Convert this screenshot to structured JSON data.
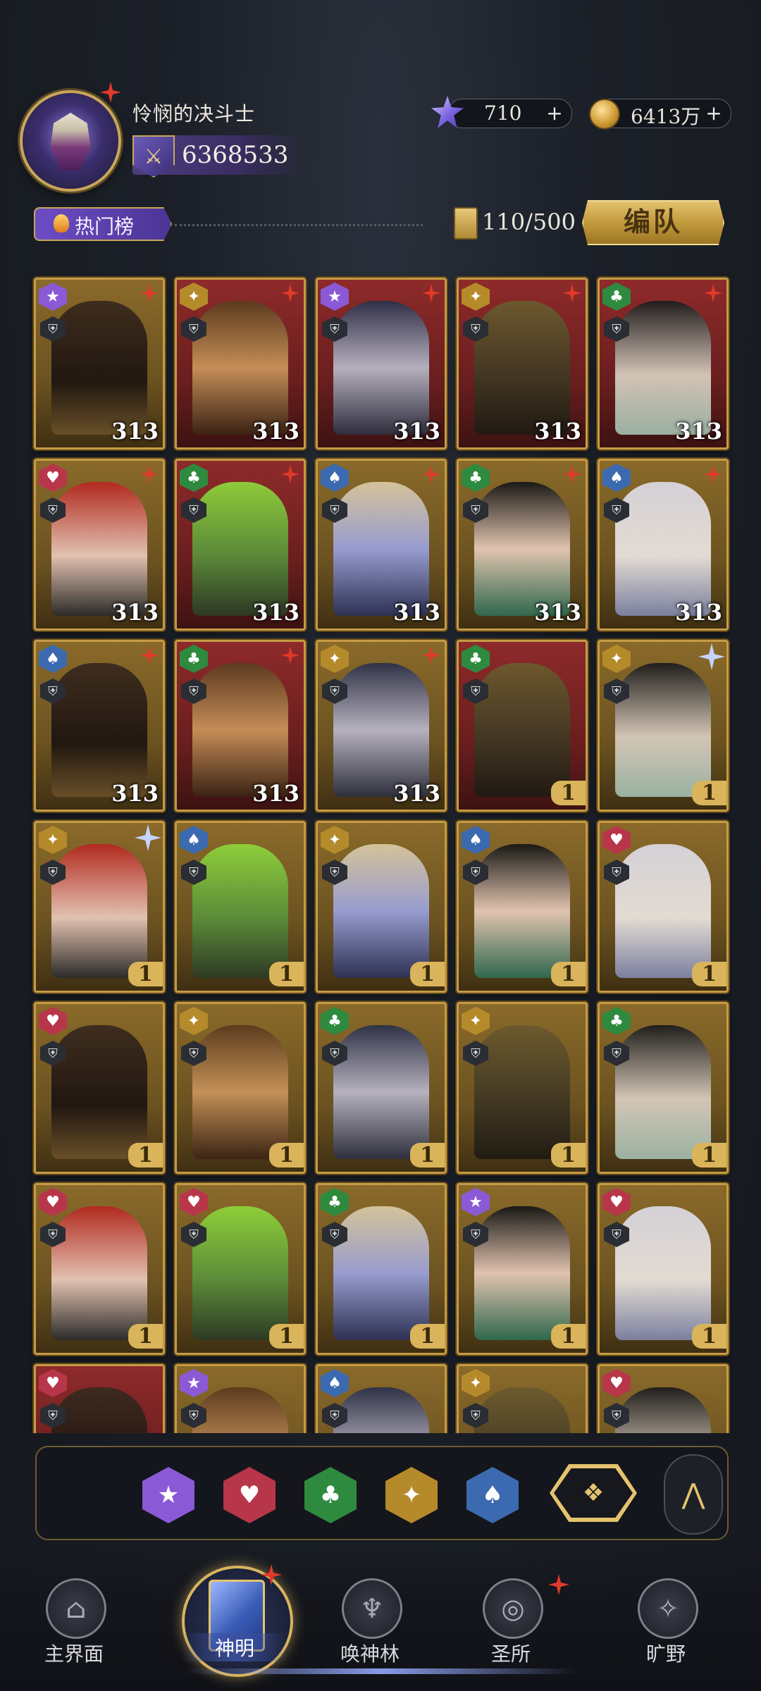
{
  "header": {
    "player_name": "怜悯的决斗士",
    "power": "6368533",
    "gems": "710",
    "coins": "6413万",
    "plus": "+"
  },
  "toolbar": {
    "hot_tab_label": "热门榜",
    "roster_count": "110/500",
    "team_button_label": "编队"
  },
  "cards": [
    {
      "faction": "star",
      "color": "gold",
      "level": "313"
    },
    {
      "faction": "diamond",
      "color": "red",
      "level": "313"
    },
    {
      "faction": "star",
      "color": "red",
      "level": "313"
    },
    {
      "faction": "diamond",
      "color": "red",
      "level": "313"
    },
    {
      "faction": "club",
      "color": "red",
      "level": "313"
    },
    {
      "faction": "heart",
      "color": "gold",
      "level": "313"
    },
    {
      "faction": "club",
      "color": "red",
      "level": "313"
    },
    {
      "faction": "spade",
      "color": "gold",
      "level": "313"
    },
    {
      "faction": "club",
      "color": "gold",
      "level": "313"
    },
    {
      "faction": "spade",
      "color": "gold",
      "level": "313"
    },
    {
      "faction": "spade",
      "color": "gold",
      "level": "313"
    },
    {
      "faction": "club",
      "color": "red",
      "level": "313"
    },
    {
      "faction": "diamond",
      "color": "gold",
      "level": "313"
    },
    {
      "faction": "club",
      "color": "red",
      "level": "1"
    },
    {
      "faction": "diamond",
      "color": "gold",
      "level": "1"
    },
    {
      "faction": "diamond",
      "color": "gold",
      "level": "1"
    },
    {
      "faction": "spade",
      "color": "gold",
      "level": "1"
    },
    {
      "faction": "diamond",
      "color": "gold",
      "level": "1"
    },
    {
      "faction": "spade",
      "color": "gold",
      "level": "1"
    },
    {
      "faction": "heart",
      "color": "gold",
      "level": "1"
    },
    {
      "faction": "heart",
      "color": "gold",
      "level": "1"
    },
    {
      "faction": "diamond",
      "color": "gold",
      "level": "1"
    },
    {
      "faction": "club",
      "color": "gold",
      "level": "1"
    },
    {
      "faction": "diamond",
      "color": "gold",
      "level": "1"
    },
    {
      "faction": "club",
      "color": "gold",
      "level": "1"
    },
    {
      "faction": "heart",
      "color": "gold",
      "level": "1"
    },
    {
      "faction": "heart",
      "color": "gold",
      "level": "1"
    },
    {
      "faction": "club",
      "color": "gold",
      "level": "1"
    },
    {
      "faction": "star",
      "color": "gold",
      "level": "1"
    },
    {
      "faction": "heart",
      "color": "gold",
      "level": "1"
    },
    {
      "faction": "heart",
      "color": "red",
      "level": ""
    },
    {
      "faction": "star",
      "color": "gold",
      "level": ""
    },
    {
      "faction": "spade",
      "color": "gold",
      "level": ""
    },
    {
      "faction": "diamond",
      "color": "gold",
      "level": ""
    },
    {
      "faction": "heart",
      "color": "gold",
      "level": ""
    }
  ],
  "filters": [
    "star",
    "heart",
    "club",
    "diamond",
    "spade"
  ],
  "nav": {
    "items": [
      {
        "label": "主界面",
        "icon": "home-icon"
      },
      {
        "label": "神明",
        "icon": "book-icon"
      },
      {
        "label": "唤神林",
        "icon": "tree-icon"
      },
      {
        "label": "圣所",
        "icon": "sanctuary-icon"
      },
      {
        "label": "旷野",
        "icon": "compass-icon"
      }
    ]
  }
}
